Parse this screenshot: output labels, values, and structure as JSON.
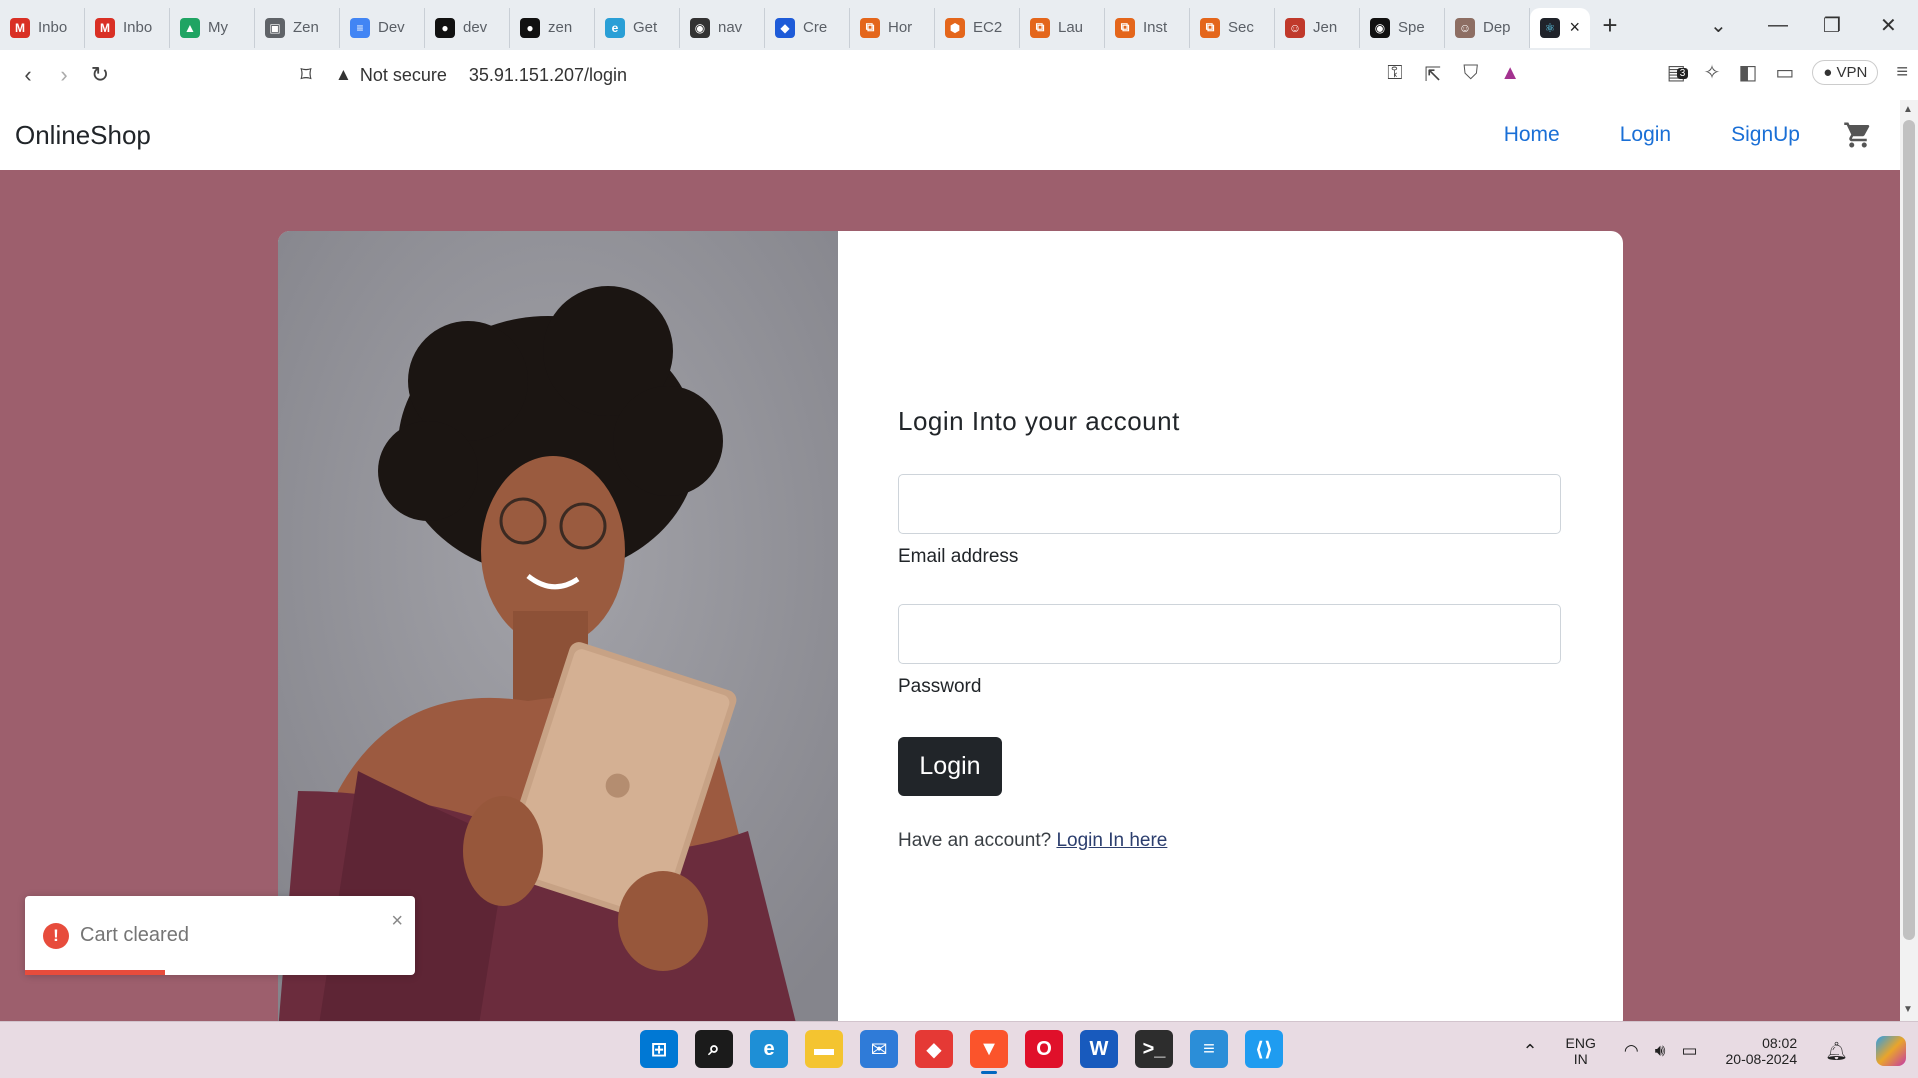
{
  "browser": {
    "tabs": [
      {
        "label": "Inbo",
        "icon": "gmail-icon",
        "color": "#d93025",
        "glyph": "M"
      },
      {
        "label": "Inbo",
        "icon": "gmail-icon",
        "color": "#d93025",
        "glyph": "M"
      },
      {
        "label": "My",
        "icon": "google-drive-icon",
        "color": "#1fa463",
        "glyph": "▲"
      },
      {
        "label": "Zen",
        "icon": "window-icon",
        "color": "#5f6368",
        "glyph": "▣"
      },
      {
        "label": "Dev",
        "icon": "google-docs-icon",
        "color": "#4285f4",
        "glyph": "≡"
      },
      {
        "label": "dev",
        "icon": "github-icon",
        "color": "#111111",
        "glyph": "●"
      },
      {
        "label": "zen",
        "icon": "github-icon",
        "color": "#111111",
        "glyph": "●"
      },
      {
        "label": "Get",
        "icon": "edge-icon",
        "color": "#2a9fd6",
        "glyph": "e"
      },
      {
        "label": "nav",
        "icon": "site-icon",
        "color": "#333333",
        "glyph": "◉"
      },
      {
        "label": "Cre",
        "icon": "cloud-icon",
        "color": "#1e5bd8",
        "glyph": "◆"
      },
      {
        "label": "Hor",
        "icon": "aws-icon",
        "color": "#e4661b",
        "glyph": "⧉"
      },
      {
        "label": "EC2",
        "icon": "ec2-icon",
        "color": "#e4661b",
        "glyph": "⬢"
      },
      {
        "label": "Lau",
        "icon": "aws-icon",
        "color": "#e4661b",
        "glyph": "⧉"
      },
      {
        "label": "Inst",
        "icon": "aws-icon",
        "color": "#e4661b",
        "glyph": "⧉"
      },
      {
        "label": "Sec",
        "icon": "aws-icon",
        "color": "#e4661b",
        "glyph": "⧉"
      },
      {
        "label": "Jen",
        "icon": "jenkins-icon",
        "color": "#c0392b",
        "glyph": "☺"
      },
      {
        "label": "Spe",
        "icon": "site-icon",
        "color": "#111111",
        "glyph": "◉"
      },
      {
        "label": "Dep",
        "icon": "avatar-icon",
        "color": "#8d6e63",
        "glyph": "☺"
      }
    ],
    "active_tab": {
      "icon": "react-icon",
      "color": "#61dafb",
      "glyph": "⚛"
    },
    "not_secure": "Not secure",
    "url": "35.91.151.207/login",
    "vpn": "VPN",
    "extension_badge": "3"
  },
  "page": {
    "brand": "OnlineShop",
    "nav": {
      "home": "Home",
      "login": "Login",
      "signup": "SignUp"
    },
    "form": {
      "title": "Login Into your account",
      "email_label": "Email address",
      "email_value": "",
      "password_label": "Password",
      "password_value": "",
      "submit": "Login",
      "hint": "Have an account?",
      "hint_link": "Login In here"
    },
    "colors": {
      "background": "#9d5f6d",
      "link": "#1a6fd6",
      "button": "#212529"
    }
  },
  "toast": {
    "message": "Cart cleared",
    "icon": "error-icon",
    "icon_glyph": "!",
    "close": "×",
    "color": "#e74c3c",
    "progress": 0.36
  },
  "taskbar": {
    "apps": [
      {
        "name": "start-icon",
        "glyph": "⊞",
        "color": "#0078d4"
      },
      {
        "name": "search-icon",
        "glyph": "⌕",
        "color": "#1b1b1b"
      },
      {
        "name": "edge-icon",
        "glyph": "e",
        "color": "#1e8fd6"
      },
      {
        "name": "file-explorer-icon",
        "glyph": "▬",
        "color": "#f4c430"
      },
      {
        "name": "mail-icon",
        "glyph": "✉",
        "color": "#2f7bd8"
      },
      {
        "name": "app-icon",
        "glyph": "◆",
        "color": "#e53935"
      },
      {
        "name": "brave-icon",
        "glyph": "▼",
        "color": "#fb542b",
        "active": true
      },
      {
        "name": "opera-icon",
        "glyph": "O",
        "color": "#e0102a"
      },
      {
        "name": "word-icon",
        "glyph": "W",
        "color": "#185abd"
      },
      {
        "name": "terminal-icon",
        "glyph": ">_",
        "color": "#2d2d2d"
      },
      {
        "name": "notepad-icon",
        "glyph": "≡",
        "color": "#2b8ed8"
      },
      {
        "name": "vscode-icon",
        "glyph": "⟨⟩",
        "color": "#1f9cf0"
      }
    ],
    "lang": "ENG",
    "region": "IN",
    "time": "08:02",
    "date": "20-08-2024"
  }
}
